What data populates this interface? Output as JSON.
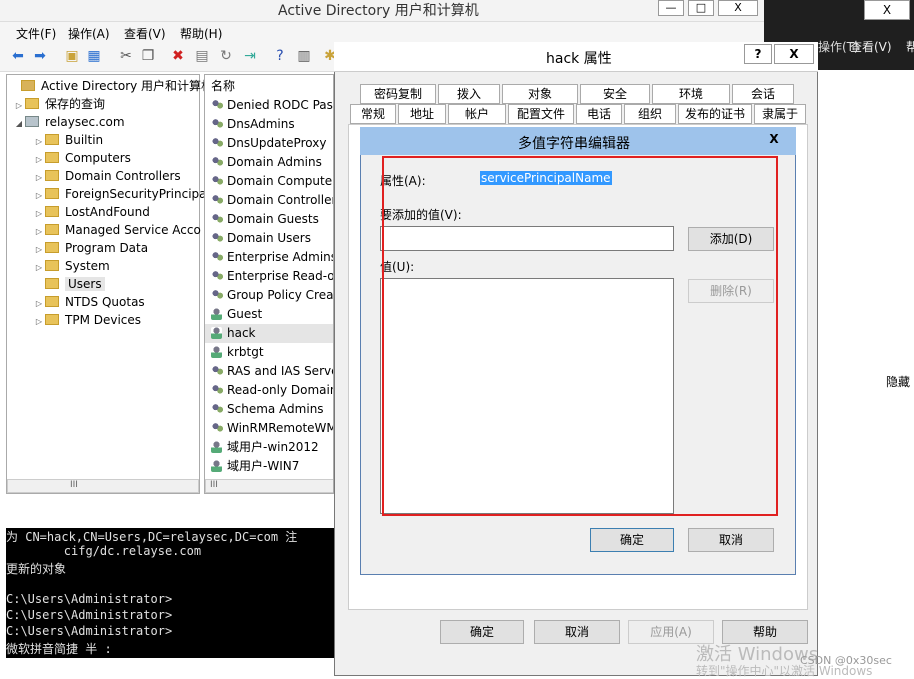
{
  "main_window": {
    "title": "Active Directory 用户和计算机",
    "controls": [
      "—",
      "□",
      "X"
    ],
    "menu": [
      "文件(F)",
      "操作(A)",
      "查看(V)",
      "帮助(H)"
    ],
    "tree": [
      {
        "label": "Active Directory 用户和计算机",
        "arrow": ""
      },
      {
        "label": "保存的查询",
        "arrow": "▷"
      },
      {
        "label": "relaysec.com",
        "arrow": "◢"
      },
      {
        "label": "Builtin",
        "arrow": "▷"
      },
      {
        "label": "Computers",
        "arrow": "▷"
      },
      {
        "label": "Domain Controllers",
        "arrow": "▷"
      },
      {
        "label": "ForeignSecurityPrincipa",
        "arrow": "▷"
      },
      {
        "label": "LostAndFound",
        "arrow": "▷"
      },
      {
        "label": "Managed Service Acco",
        "arrow": "▷"
      },
      {
        "label": "Program Data",
        "arrow": "▷"
      },
      {
        "label": "System",
        "arrow": "▷"
      },
      {
        "label": "Users",
        "arrow": ""
      },
      {
        "label": "NTDS Quotas",
        "arrow": "▷"
      },
      {
        "label": "TPM Devices",
        "arrow": "▷"
      }
    ],
    "list_header": "名称",
    "list": [
      "Denied RODC Pas",
      "DnsAdmins",
      "DnsUpdateProxy",
      "Domain Admins",
      "Domain Computer",
      "Domain Controller",
      "Domain Guests",
      "Domain Users",
      "Enterprise Admins",
      "Enterprise Read-o",
      "Group Policy Crea",
      "Guest",
      "hack",
      "krbtgt",
      "RAS and IAS Serve",
      "Read-only Domain",
      "Schema Admins",
      "WinRMRemoteWM",
      "域用户-win2012",
      "域用户-WIN7"
    ],
    "scroll_thumb": "III"
  },
  "console": {
    "lines": [
      "为 CN=hack,CN=Users,DC=relaysec,DC=com 注",
      "        cifg/dc.relayse.com",
      "更新的对象",
      "",
      "C:\\Users\\Administrator>",
      "C:\\Users\\Administrator>",
      "C:\\Users\\Administrator>",
      "微软拼音简捷 半 :"
    ]
  },
  "right_panel": {
    "menu_fragment": "查看(V)",
    "menu_fragment2": "操作(T)",
    "menu_fragment3": "帮",
    "hide_label": "隐藏",
    "close": "X"
  },
  "properties_dialog": {
    "title": "hack 属性",
    "help": "?",
    "close": "X",
    "tabs_row1": [
      "密码复制",
      "拨入",
      "对象",
      "安全",
      "环境",
      "会话"
    ],
    "tabs_row2": [
      "常规",
      "地址",
      "帐户",
      "配置文件",
      "电话",
      "组织",
      "发布的证书",
      "隶属于"
    ],
    "buttons": {
      "ok": "确定",
      "cancel": "取消",
      "apply": "应用(A)",
      "help": "帮助"
    }
  },
  "string_editor": {
    "title": "多值字符串编辑器",
    "close": "X",
    "attribute_label": "属性(A):",
    "attribute_value": "servicePrincipalName",
    "add_value_label": "要添加的值(V):",
    "add_value": "",
    "add_button": "添加(D)",
    "values_label": "值(U):",
    "remove_button": "删除(R)",
    "ok": "确定",
    "cancel": "取消"
  },
  "watermark": {
    "line1": "激活 Windows",
    "line2": "转到\"操作中心\"以激活 Windows",
    "credit": "CSDN @0x30sec"
  }
}
